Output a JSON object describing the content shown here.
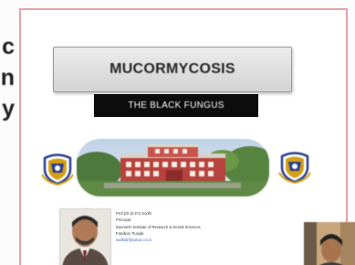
{
  "side_panel": {
    "text_fragments": [
      "c",
      "n",
      "y"
    ]
  },
  "slide": {
    "title": "MUCORMYCOSIS",
    "subtitle": "THE BLACK FUNGUS",
    "speaker": {
      "name": "Prof.(Dr.)S.P.S Sodhi",
      "role": "Principal",
      "institution": "Dasmesh Institute of Research & Dental Sciences",
      "location": "Faridkot, Punjab",
      "email": "sodhidr@yahoo.co.in"
    }
  },
  "icons": {
    "left_emblem": "crest-emblem-icon",
    "right_emblem": "crest-emblem-icon"
  },
  "colors": {
    "slide_border": "#e6a3a8",
    "title_box_bg": "#d9d9d9",
    "subtitle_bg": "#0c0c0c",
    "subtitle_text": "#ffffff",
    "emblem_blue": "#2a3f8f",
    "emblem_gold": "#d4a017"
  }
}
